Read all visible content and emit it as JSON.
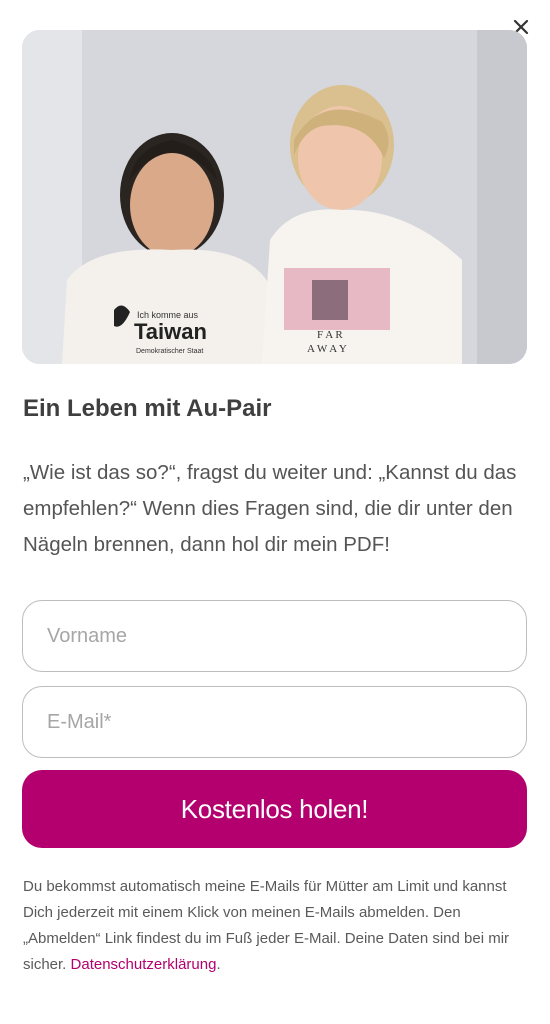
{
  "popup": {
    "close_icon": "close-icon",
    "image": {
      "shirt_left_line1": "Ich komme aus",
      "shirt_left_line2": "Taiwan",
      "shirt_left_line3": "Demokratischer Staat",
      "shirt_right_line1": "F A R",
      "shirt_right_line2": "A W A Y"
    },
    "title": "Ein Leben mit Au-Pair",
    "intro": "„Wie ist das so?“, fragst du weiter und: „Kannst du das empfehlen?“ Wenn dies Fragen sind, die dir unter den Nägeln brennen, dann hol dir mein PDF!",
    "form": {
      "firstname_placeholder": "Vorname",
      "email_placeholder": "E-Mail*",
      "submit_label": "Kostenlos holen!"
    },
    "legal": {
      "text": "Du bekommst automatisch meine E-Mails für Mütter am Limit und kannst Dich jederzeit mit einem Klick von meinen E-Mails abmelden. Den „Abmelden“ Link findest du im  Fuß jeder E-Mail. Deine Daten sind bei mir sicher. ",
      "privacy_link": "Datenschutzerklärung",
      "trailing": "."
    },
    "colors": {
      "accent": "#b3006e",
      "text": "#555555"
    }
  }
}
